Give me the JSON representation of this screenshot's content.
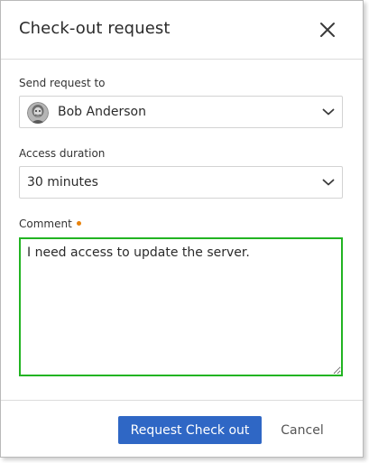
{
  "dialog": {
    "title": "Check-out request",
    "close_icon": "close-icon"
  },
  "send_to": {
    "label": "Send request to",
    "value": "Bob Anderson",
    "avatar_icon": "user-avatar",
    "chevron_icon": "chevron-down-icon"
  },
  "duration": {
    "label": "Access duration",
    "value": "30 minutes",
    "chevron_icon": "chevron-down-icon"
  },
  "comment": {
    "label": "Comment",
    "required_color": "#e8820c",
    "value": "I need access to update the server.",
    "focus_color": "#22b422"
  },
  "footer": {
    "primary_label": "Request Check out",
    "primary_color": "#2f67c5",
    "cancel_label": "Cancel"
  }
}
